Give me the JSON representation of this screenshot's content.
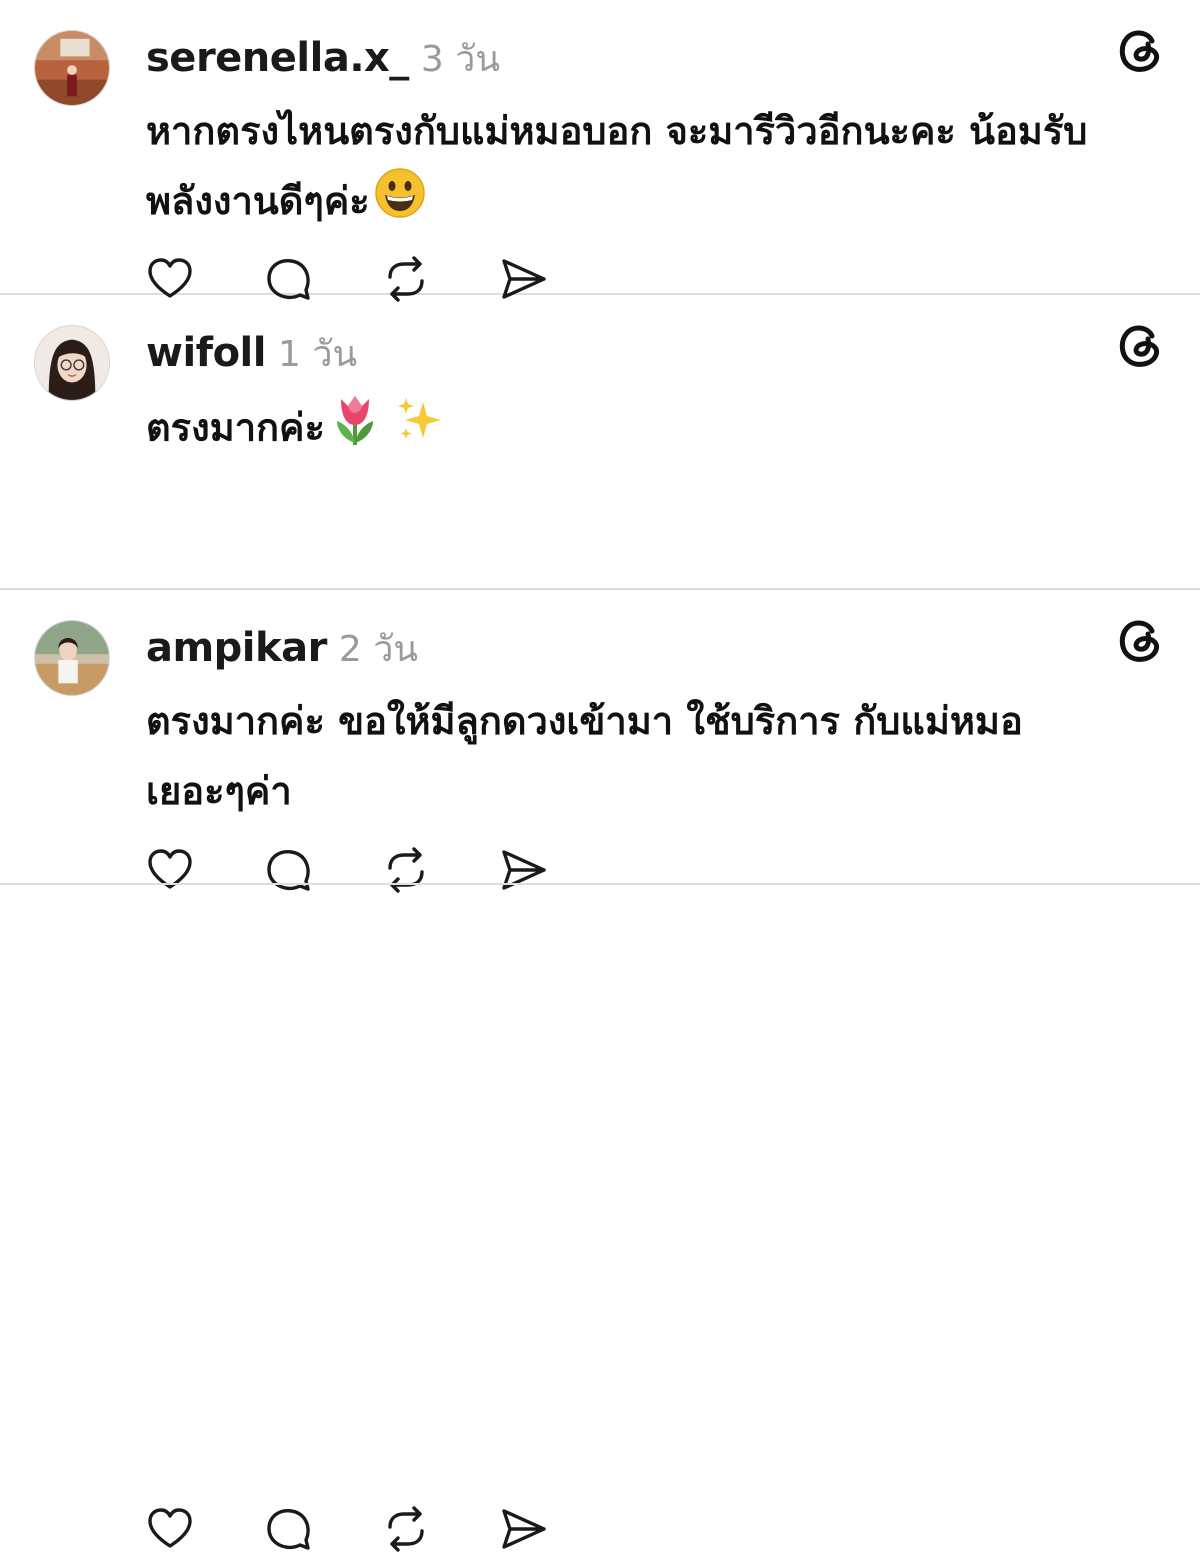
{
  "posts": [
    {
      "username": "serenella.x_",
      "time": "3 วัน",
      "text": "หากตรงไหนตรงกับแม่หมอบอก จะมารีวิวอีกนะคะ น้อมรับพลังงานดีๆค่ะ",
      "emoji": "grinning-face"
    },
    {
      "username": "wifoll",
      "time": "1 วัน",
      "text": "ตรงมากค่ะ",
      "emoji": "tulip-sparkles"
    },
    {
      "username": "ampikar",
      "time": "2 วัน",
      "text": "ตรงมากค่ะ ขอให้มีลูกดวงเข้ามา ใช้บริการ กับแม่หมอเยอะๆค่า",
      "emoji": ""
    }
  ],
  "icons": {
    "like": "heart-icon",
    "reply": "comment-icon",
    "repost": "repost-icon",
    "share": "share-icon",
    "app": "threads-logo-icon"
  }
}
